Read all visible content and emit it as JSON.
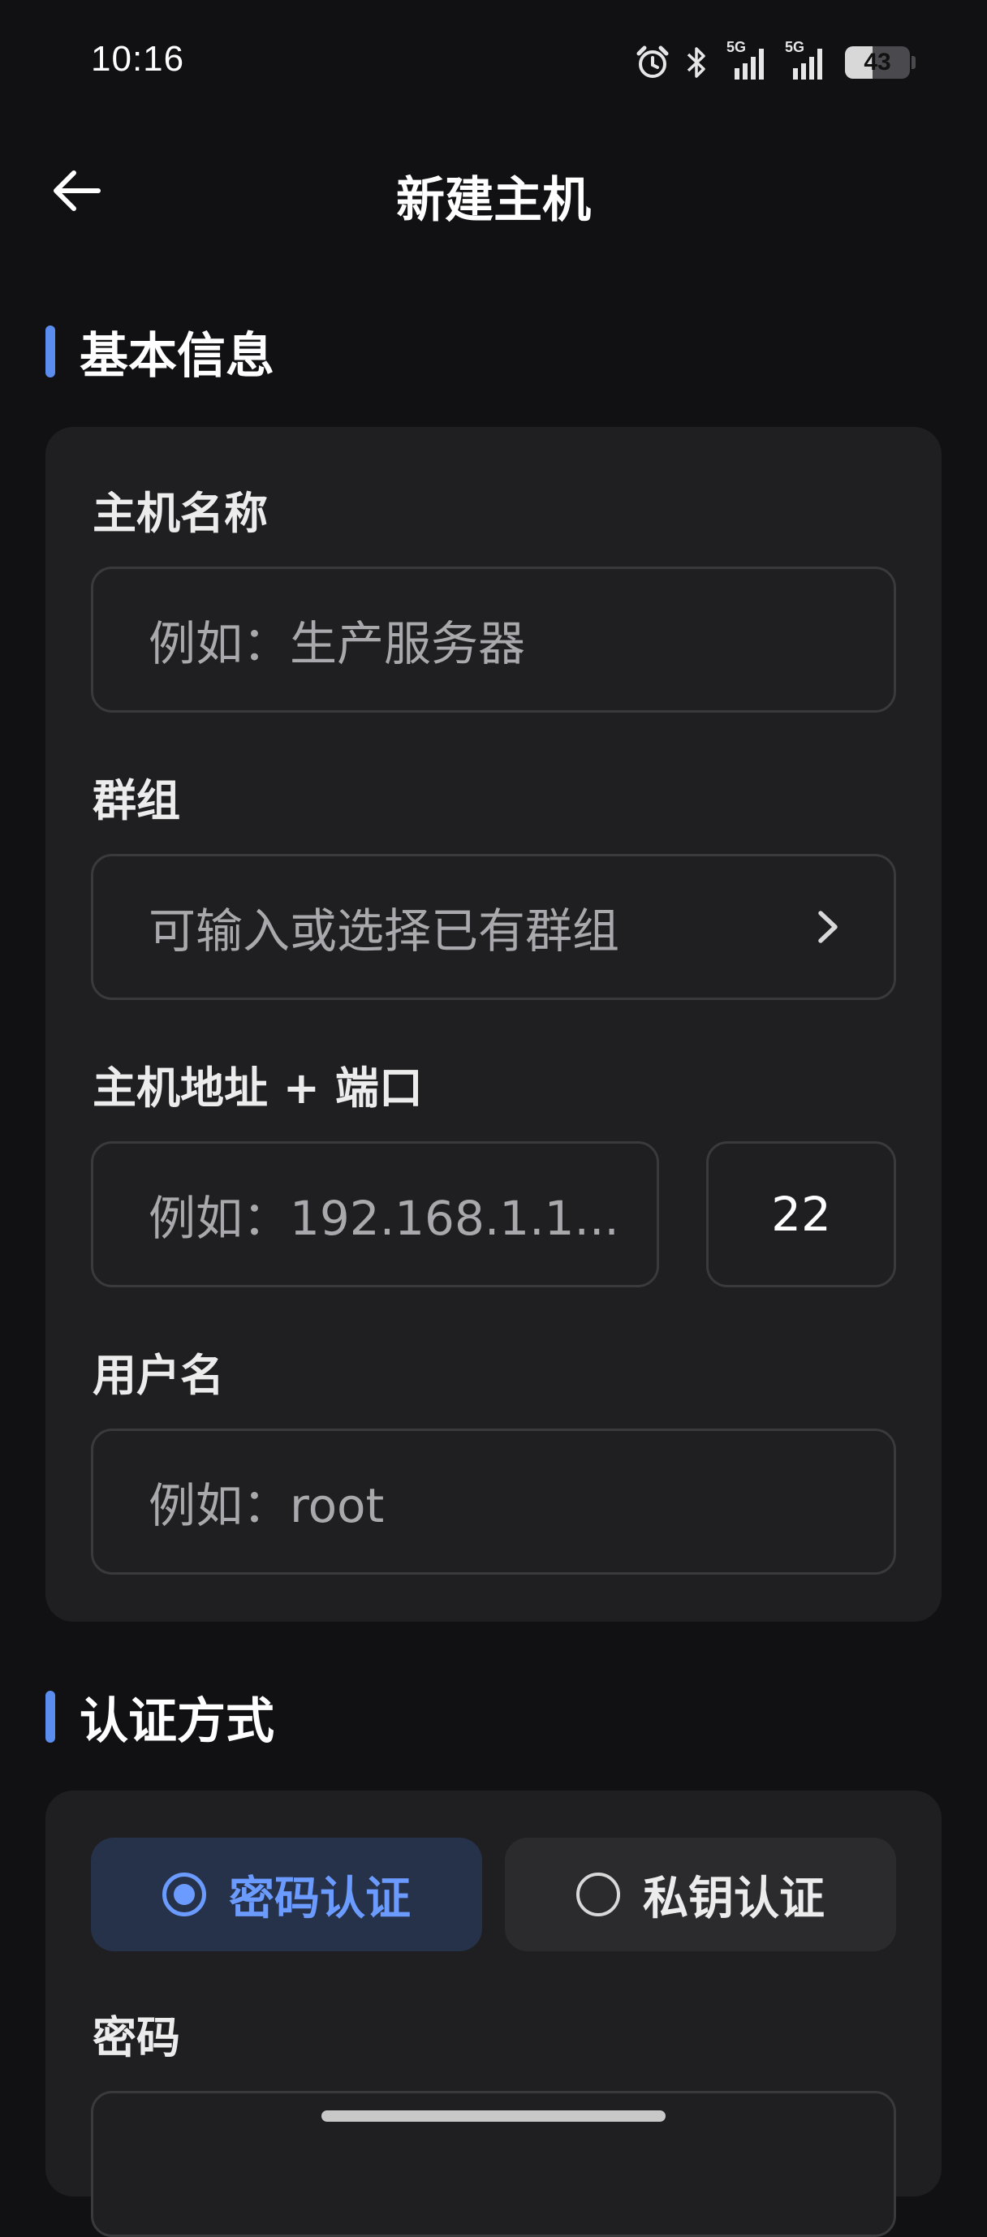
{
  "status": {
    "time": "10:16",
    "battery": "43",
    "battery_level": 0.43,
    "network_1": "5G",
    "network_2": "5G",
    "icons": [
      "alarm-icon",
      "bluetooth-icon",
      "signal-5g-icon",
      "signal-5g-icon",
      "battery-icon"
    ]
  },
  "header": {
    "title": "新建主机",
    "back_icon": "arrow-left-icon"
  },
  "sections": {
    "basic": "基本信息",
    "auth": "认证方式"
  },
  "basic": {
    "name_label": "主机名称",
    "name_placeholder": "例如：生产服务器",
    "group_label": "群组",
    "group_placeholder": "可输入或选择已有群组",
    "address_label": "主机地址 + 端口",
    "address_placeholder": "例如：192.168.1.1...",
    "port_value": "22",
    "username_label": "用户名",
    "username_placeholder": "例如：root"
  },
  "auth": {
    "password_tab": "密码认证",
    "key_tab": "私钥认证",
    "selected": "password",
    "password_label": "密码"
  },
  "colors": {
    "accent": "#5b8def",
    "background": "#111113",
    "card": "#1f1f21"
  }
}
